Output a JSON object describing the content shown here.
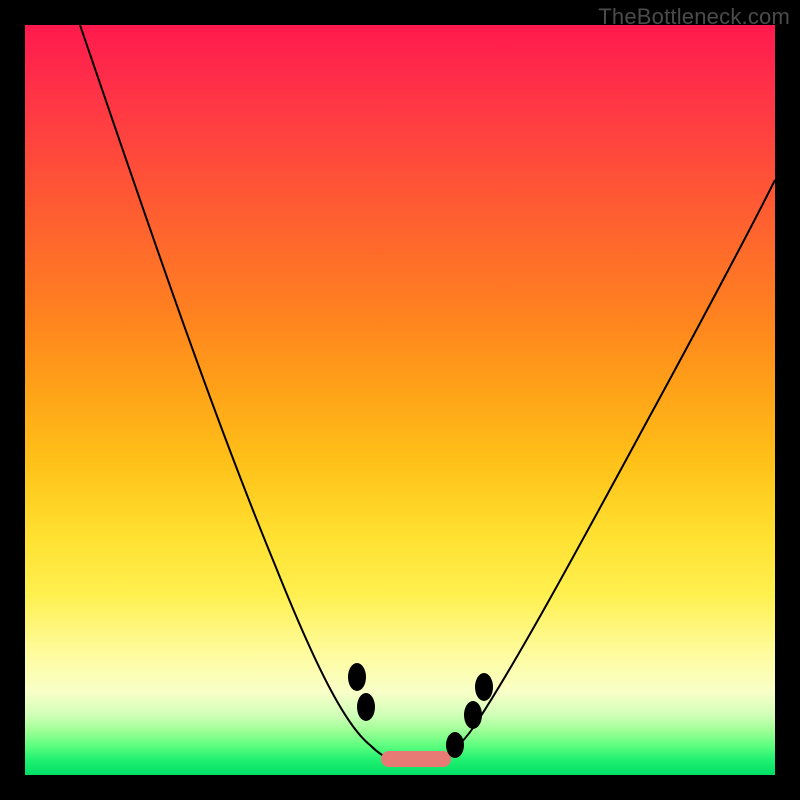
{
  "attribution": "TheBottleneck.com",
  "chart_data": {
    "type": "line",
    "title": "",
    "xlabel": "",
    "ylabel": "",
    "xlim": [
      0,
      100
    ],
    "ylim": [
      0,
      100
    ],
    "series": [
      {
        "name": "bottleneck-curve",
        "x": [
          0,
          6,
          12,
          18,
          24,
          30,
          36,
          40,
          44,
          48,
          50,
          52,
          54,
          58,
          62,
          66,
          72,
          80,
          90,
          100
        ],
        "y": [
          100,
          92,
          83,
          73,
          63,
          52,
          40,
          30,
          18,
          6,
          3,
          3,
          5,
          11,
          20,
          30,
          43,
          58,
          73,
          85
        ]
      }
    ],
    "markers": {
      "name": "highlight-points",
      "x": [
        44.0,
        45.3,
        49.0,
        53.5,
        56.0,
        58.7,
        60.0
      ],
      "y": [
        14.0,
        10.5,
        3.0,
        3.0,
        5.5,
        9.5,
        13.0
      ]
    },
    "background_gradient": {
      "top": "#ff1a4d",
      "upper_mid": "#ff8020",
      "mid": "#ffe030",
      "lower_mid": "#fffca0",
      "bottom": "#00de66"
    }
  }
}
